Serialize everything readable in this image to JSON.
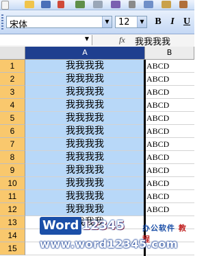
{
  "formatting_toolbar": {
    "font_name": "宋体",
    "font_size": "12",
    "bold_label": "B",
    "italic_label": "I",
    "underline_label": "U"
  },
  "formula_bar": {
    "name_box": "",
    "fx_label": "fx",
    "value": "我我我我"
  },
  "columns": [
    "A",
    "B"
  ],
  "rows": [
    {
      "num": "1",
      "a": "我我我我",
      "b": "ABCD"
    },
    {
      "num": "2",
      "a": "我我我我",
      "b": "ABCD"
    },
    {
      "num": "3",
      "a": "我我我我",
      "b": "ABCD"
    },
    {
      "num": "4",
      "a": "我我我我",
      "b": "ABCD"
    },
    {
      "num": "5",
      "a": "我我我我",
      "b": "ABCD"
    },
    {
      "num": "6",
      "a": "我我我我",
      "b": "ABCD"
    },
    {
      "num": "7",
      "a": "我我我我",
      "b": "ABCD"
    },
    {
      "num": "8",
      "a": "我我我我",
      "b": "ABCD"
    },
    {
      "num": "9",
      "a": "我我我我",
      "b": "ABCD"
    },
    {
      "num": "10",
      "a": "我我我我",
      "b": "ABCD"
    },
    {
      "num": "11",
      "a": "我我我我",
      "b": "ABCD"
    },
    {
      "num": "12",
      "a": "我我我我",
      "b": "ABCD"
    },
    {
      "num": "13",
      "a": "我我我我",
      "b": ""
    },
    {
      "num": "14",
      "a": "",
      "b": ""
    },
    {
      "num": "15",
      "a": "",
      "b": ""
    }
  ],
  "watermark": {
    "brand_word": "Word",
    "brand_num": "12345",
    "tagline": "办公软件",
    "tagline_red": "教程",
    "url": "www.word12345.com"
  },
  "colors": {
    "selected_column_header": "#1f3f8f",
    "selected_cells": "#b8d8f8",
    "row_header": "#f9c86d"
  }
}
